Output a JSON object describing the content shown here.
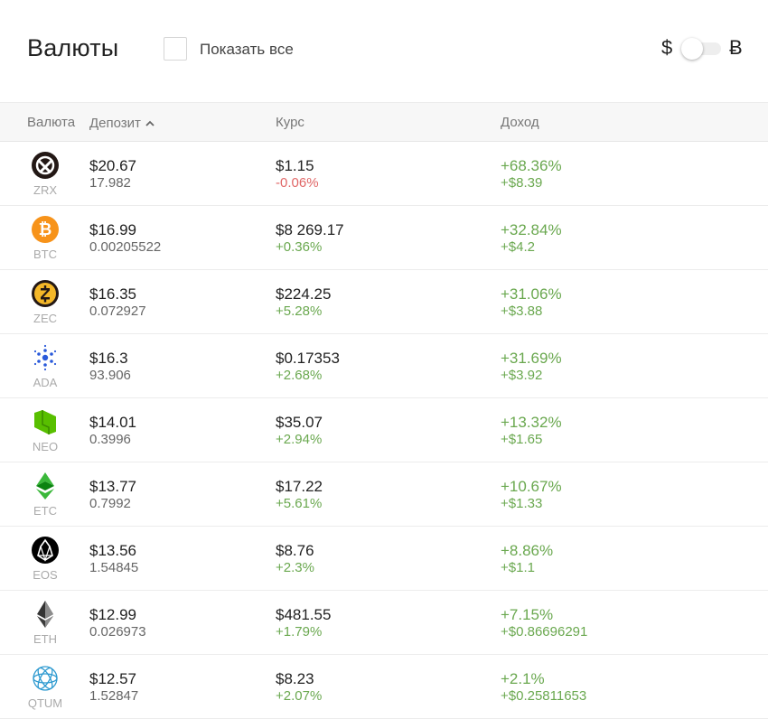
{
  "header": {
    "title": "Валюты",
    "show_all_label": "Показать все",
    "usd_symbol": "$",
    "btc_symbol": "Ƀ"
  },
  "table": {
    "columns": {
      "currency": "Валюта",
      "deposit": "Депозит",
      "rate": "Курс",
      "income": "Доход"
    },
    "rows": [
      {
        "symbol": "ZRX",
        "icon": "zrx-icon",
        "deposit_usd": "$20.67",
        "deposit_amount": "17.982",
        "rate": "$1.15",
        "rate_change": "-0.06%",
        "rate_dir": "neg",
        "income_pct": "+68.36%",
        "income_usd": "+$8.39"
      },
      {
        "symbol": "BTC",
        "icon": "btc-icon",
        "deposit_usd": "$16.99",
        "deposit_amount": "0.00205522",
        "rate": "$8 269.17",
        "rate_change": "+0.36%",
        "rate_dir": "pos",
        "income_pct": "+32.84%",
        "income_usd": "+$4.2"
      },
      {
        "symbol": "ZEC",
        "icon": "zec-icon",
        "deposit_usd": "$16.35",
        "deposit_amount": "0.072927",
        "rate": "$224.25",
        "rate_change": "+5.28%",
        "rate_dir": "pos",
        "income_pct": "+31.06%",
        "income_usd": "+$3.88"
      },
      {
        "symbol": "ADA",
        "icon": "ada-icon",
        "deposit_usd": "$16.3",
        "deposit_amount": "93.906",
        "rate": "$0.17353",
        "rate_change": "+2.68%",
        "rate_dir": "pos",
        "income_pct": "+31.69%",
        "income_usd": "+$3.92"
      },
      {
        "symbol": "NEO",
        "icon": "neo-icon",
        "deposit_usd": "$14.01",
        "deposit_amount": "0.3996",
        "rate": "$35.07",
        "rate_change": "+2.94%",
        "rate_dir": "pos",
        "income_pct": "+13.32%",
        "income_usd": "+$1.65"
      },
      {
        "symbol": "ETC",
        "icon": "etc-icon",
        "deposit_usd": "$13.77",
        "deposit_amount": "0.7992",
        "rate": "$17.22",
        "rate_change": "+5.61%",
        "rate_dir": "pos",
        "income_pct": "+10.67%",
        "income_usd": "+$1.33"
      },
      {
        "symbol": "EOS",
        "icon": "eos-icon",
        "deposit_usd": "$13.56",
        "deposit_amount": "1.54845",
        "rate": "$8.76",
        "rate_change": "+2.3%",
        "rate_dir": "pos",
        "income_pct": "+8.86%",
        "income_usd": "+$1.1"
      },
      {
        "symbol": "ETH",
        "icon": "eth-icon",
        "deposit_usd": "$12.99",
        "deposit_amount": "0.026973",
        "rate": "$481.55",
        "rate_change": "+1.79%",
        "rate_dir": "pos",
        "income_pct": "+7.15%",
        "income_usd": "+$0.86696291"
      },
      {
        "symbol": "QTUM",
        "icon": "qtum-icon",
        "deposit_usd": "$12.57",
        "deposit_amount": "1.52847",
        "rate": "$8.23",
        "rate_change": "+2.07%",
        "rate_dir": "pos",
        "income_pct": "+2.1%",
        "income_usd": "+$0.25811653"
      }
    ]
  },
  "colors": {
    "positive": "#6aa84f",
    "negative": "#e06666",
    "btc_orange": "#f7931a",
    "zec_gold": "#f4b728",
    "ada_blue": "#2a5ada",
    "neo_green": "#58bf00",
    "etc_green": "#328332",
    "qtum_cyan": "#2e9ad0"
  }
}
